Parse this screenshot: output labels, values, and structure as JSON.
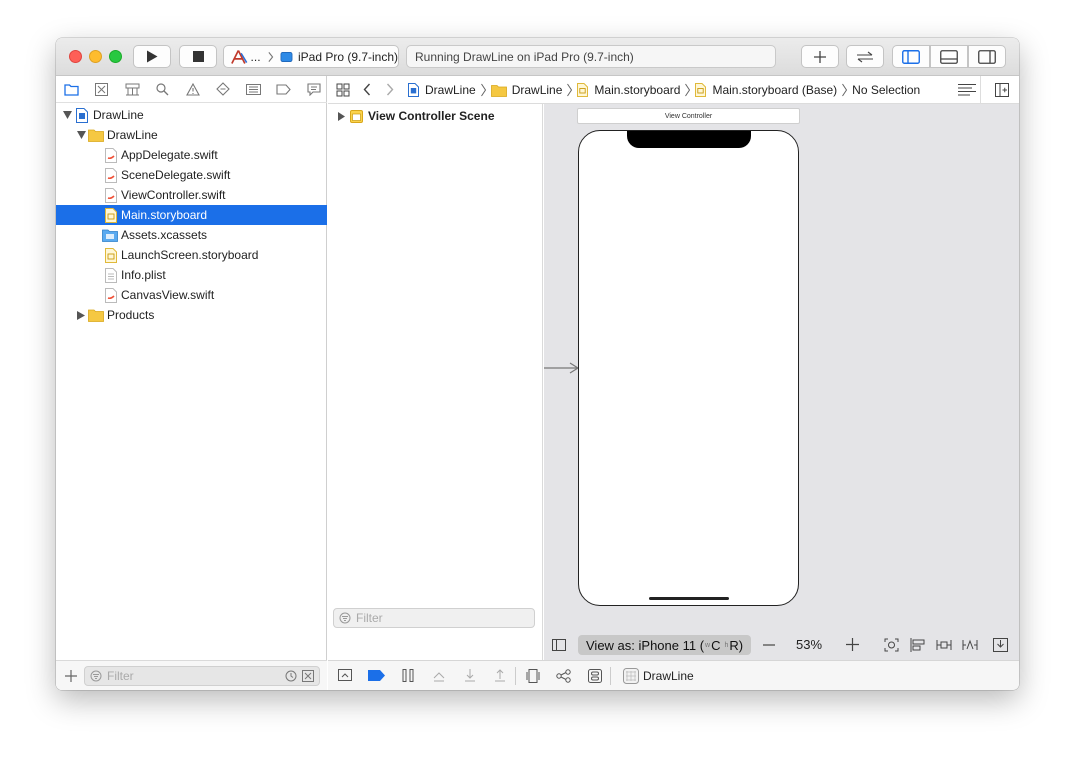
{
  "toolbar": {
    "scheme_ellipsis": "...",
    "destination": "iPad Pro (9.7-inch)",
    "activity_status": "Running DrawLine on iPad Pro (9.7-inch)"
  },
  "navigator": {
    "tree": [
      {
        "label": "DrawLine",
        "kind": "project"
      },
      {
        "label": "DrawLine",
        "kind": "folder"
      },
      {
        "label": "AppDelegate.swift",
        "kind": "swift"
      },
      {
        "label": "SceneDelegate.swift",
        "kind": "swift"
      },
      {
        "label": "ViewController.swift",
        "kind": "swift"
      },
      {
        "label": "Main.storyboard",
        "kind": "storyboard",
        "selected": true
      },
      {
        "label": "Assets.xcassets",
        "kind": "assets"
      },
      {
        "label": "LaunchScreen.storyboard",
        "kind": "storyboard"
      },
      {
        "label": "Info.plist",
        "kind": "plist"
      },
      {
        "label": "CanvasView.swift",
        "kind": "swift"
      },
      {
        "label": "Products",
        "kind": "folder"
      }
    ],
    "filter_placeholder": "Filter"
  },
  "jumpbar": {
    "crumbs": [
      "DrawLine",
      "DrawLine",
      "Main.storyboard",
      "Main.storyboard (Base)",
      "No Selection"
    ]
  },
  "outline": {
    "scene_label": "View Controller Scene",
    "filter_placeholder": "Filter"
  },
  "canvas": {
    "scene_title": "View Controller",
    "view_as_prefix": "View as: iPhone 11 (",
    "size_class_w": "wC",
    "size_class_h": "hR",
    "view_as_suffix": ")",
    "zoom": "53%"
  },
  "debug": {
    "target_label": "DrawLine"
  },
  "colors": {
    "accent": "#1b6fe8",
    "close": "#fe5f57",
    "minimize": "#febc2e",
    "zoom": "#28c840",
    "folder": "#f5c842"
  }
}
